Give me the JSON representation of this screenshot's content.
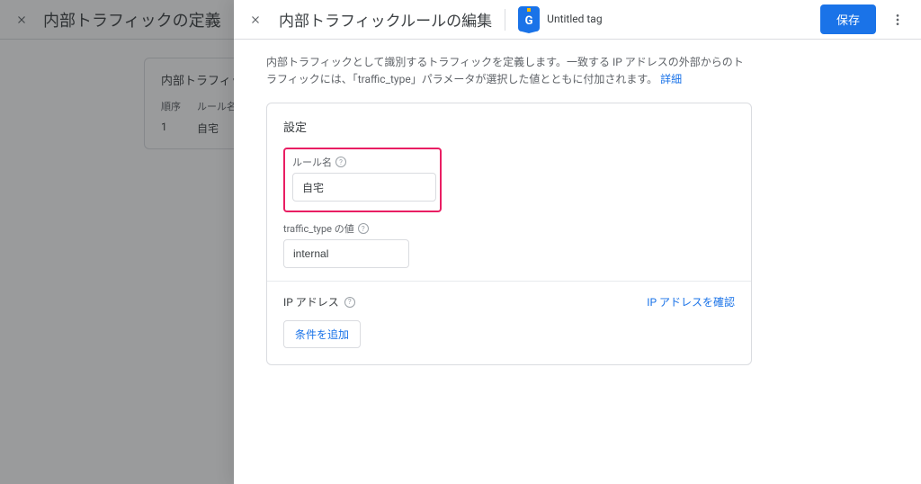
{
  "background": {
    "title": "内部トラフィックの定義",
    "tag": {
      "name": "Untitled tag",
      "sub": ""
    },
    "card": {
      "title": "内部トラフィックルール",
      "columns": {
        "order": "順序",
        "rulename": "ルール名"
      },
      "rows": [
        {
          "order": "1",
          "name": "自宅"
        }
      ]
    }
  },
  "panel": {
    "title": "内部トラフィックルールの編集",
    "tag": {
      "name": "Untitled tag",
      "sub": ""
    },
    "save": "保存",
    "description": "内部トラフィックとして識別するトラフィックを定義します。一致する IP アドレスの外部からのトラフィックには、「traffic_type」パラメータが選択した値とともに付加されます。",
    "learn_more": "詳細",
    "card": {
      "title": "設定",
      "rule_name_label": "ルール名",
      "rule_name_value": "自宅",
      "traffic_type_label": "traffic_type の値",
      "traffic_type_value": "internal",
      "ip_label": "IP アドレス",
      "ip_link": "IP アドレスを確認",
      "add_condition": "条件を追加"
    }
  }
}
